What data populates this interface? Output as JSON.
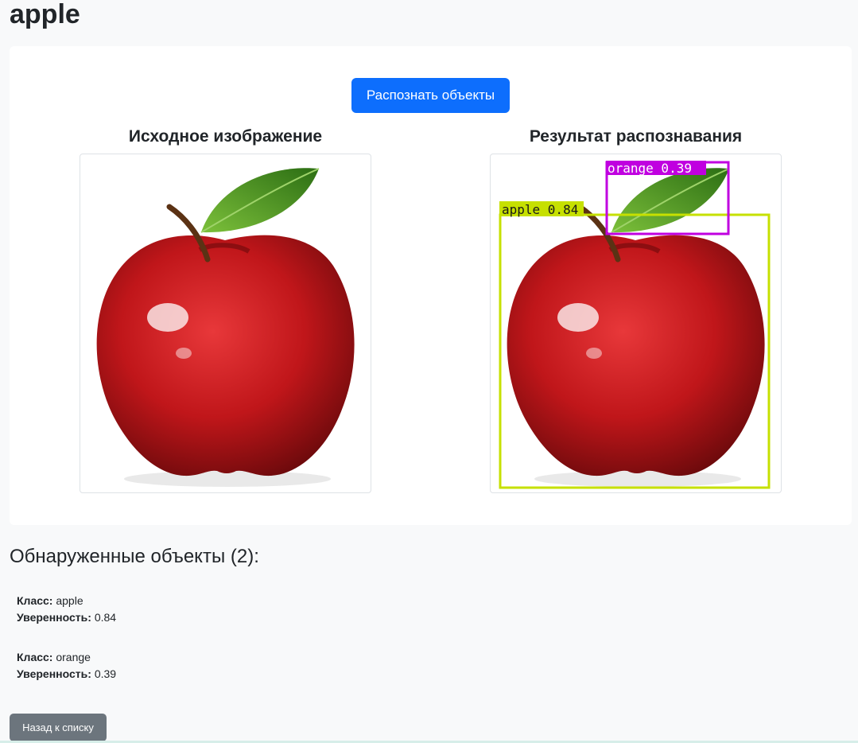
{
  "page": {
    "title": "apple"
  },
  "actions": {
    "detect_label": "Распознать объекты",
    "back_label": "Назад к списку"
  },
  "images": {
    "original_title": "Исходное изображение",
    "result_title": "Результат распознавания",
    "boxes": [
      {
        "label": "apple 0.84",
        "color": "#c6e000"
      },
      {
        "label": "orange 0.39",
        "color": "#c000e0"
      }
    ]
  },
  "detections": {
    "heading": "Обнаруженные объекты (2):",
    "class_label": "Класс:",
    "confidence_label": "Уверенность:",
    "items": [
      {
        "class": "apple",
        "confidence": "0.84"
      },
      {
        "class": "orange",
        "confidence": "0.39"
      }
    ]
  },
  "colors": {
    "primary": "#0d6efd",
    "secondary": "#6c757d",
    "apple_red": "#c0161a",
    "leaf_green": "#3e8a1e"
  }
}
